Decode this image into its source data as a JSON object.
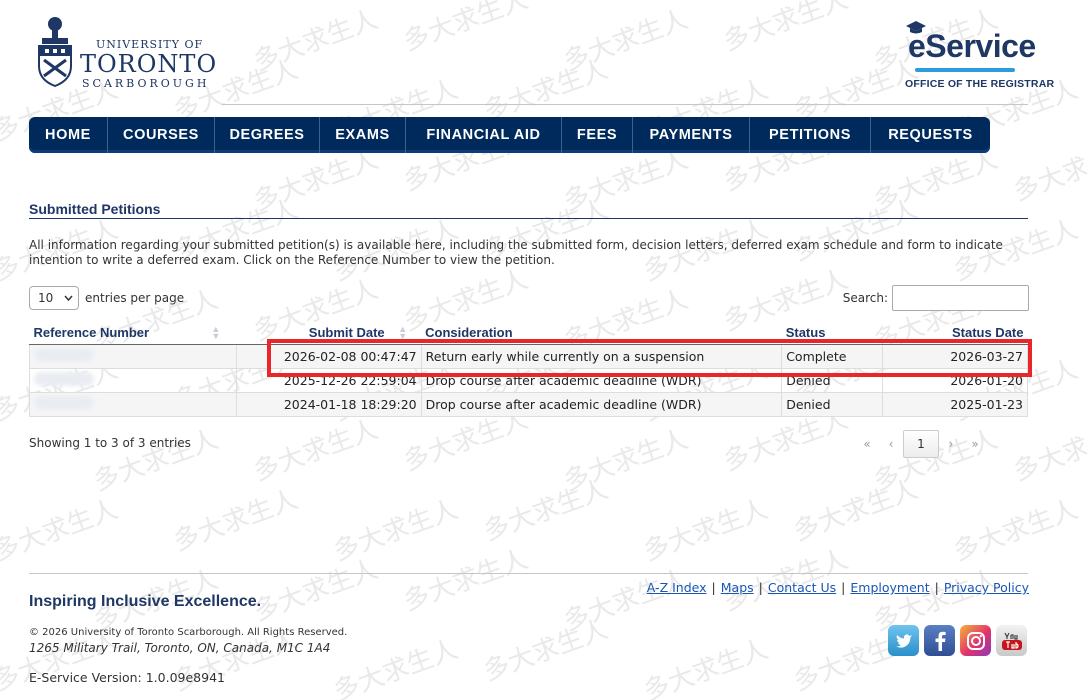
{
  "header": {
    "logo": {
      "line1": "UNIVERSITY OF",
      "line2": "TORONTO",
      "line3": "SCARBOROUGH"
    },
    "eservice": {
      "title": "eService",
      "subtitle": "OFFICE OF THE REGISTRAR"
    }
  },
  "nav": {
    "items": [
      {
        "label": "HOME"
      },
      {
        "label": "COURSES"
      },
      {
        "label": "DEGREES"
      },
      {
        "label": "EXAMS"
      },
      {
        "label": "FINANCIAL AID"
      },
      {
        "label": "FEES"
      },
      {
        "label": "PAYMENTS"
      },
      {
        "label": "PETITIONS"
      },
      {
        "label": "REQUESTS"
      }
    ]
  },
  "main": {
    "title": "Submitted Petitions",
    "intro": "All information regarding your submitted petition(s) is available here, including the submitted form, decision letters, deferred exam schedule and form to indicate intention to write a deferred exam. Click on the Reference Number to view the petition.",
    "length": {
      "value": "10",
      "label": "entries per page"
    },
    "search": {
      "label": "Search:",
      "value": ""
    },
    "table": {
      "columns": [
        "Reference Number",
        "Submit Date",
        "Consideration",
        "Status",
        "Status Date"
      ],
      "rows": [
        {
          "submit_date": "2026-02-08 00:47:47",
          "consideration": "Return early while currently on a suspension",
          "status": "Complete",
          "status_date": "2026-03-27"
        },
        {
          "submit_date": "2025-12-26 22:59:04",
          "consideration": "Drop course after academic deadline (WDR)",
          "status": "Denied",
          "status_date": "2026-01-20"
        },
        {
          "submit_date": "2024-01-18 18:29:20",
          "consideration": "Drop course after academic deadline (WDR)",
          "status": "Denied",
          "status_date": "2025-01-23"
        }
      ]
    },
    "info": "Showing 1 to 3 of 3 entries",
    "pager": {
      "first": "«",
      "prev": "‹",
      "current": "1",
      "next": "›",
      "last": "»"
    }
  },
  "footer": {
    "tagline": "Inspiring Inclusive Excellence.",
    "links": [
      "A-Z Index",
      "Maps",
      "Contact Us",
      "Employment",
      "Privacy Policy"
    ],
    "separator": "|",
    "copyright": "© 2026 University of Toronto Scarborough. All Rights Reserved.",
    "address": "1265 Military Trail, Toronto, ON, Canada, M1C 1A4",
    "version": "E-Service Version: 1.0.09e8941",
    "social": [
      "twitter-icon",
      "facebook-icon",
      "instagram-icon",
      "youtube-icon"
    ]
  },
  "watermark": "多大求生人",
  "colors": {
    "navy": "#002a5c",
    "title_blue": "#1e3765",
    "link_blue": "#1a55b5",
    "highlight_red": "#e8262c"
  }
}
